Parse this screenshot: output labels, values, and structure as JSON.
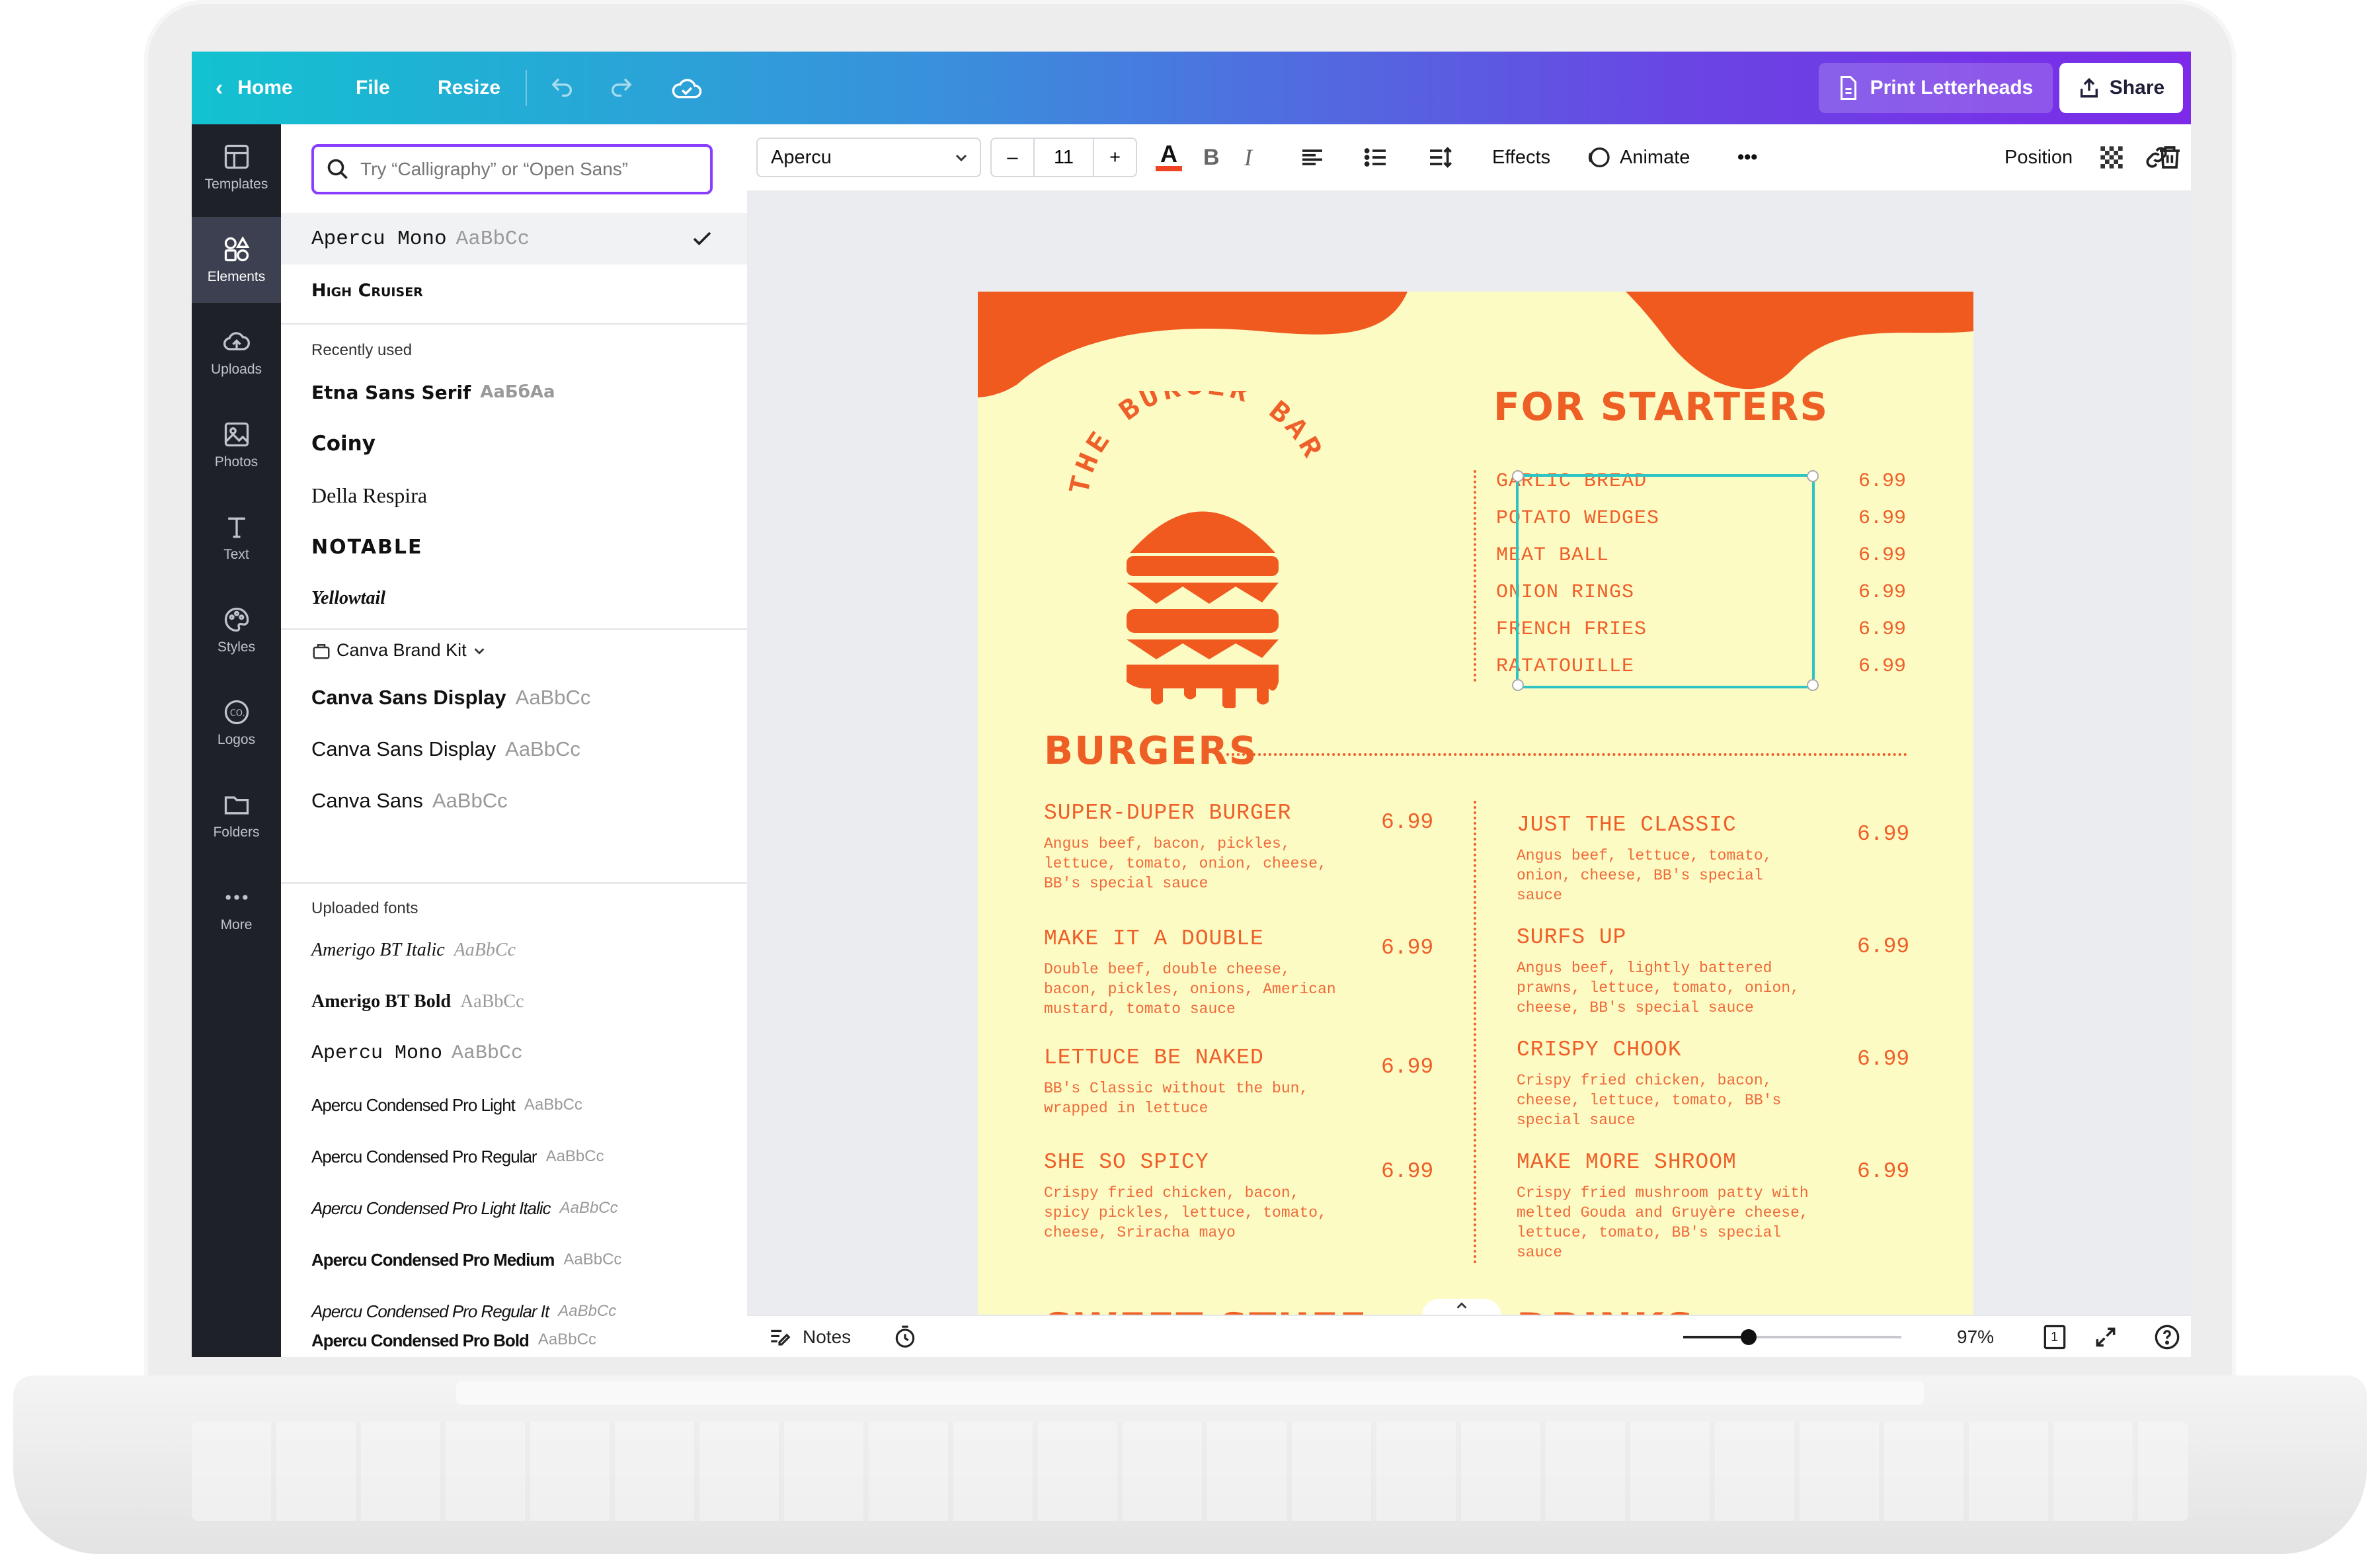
{
  "topbar": {
    "home": "Home",
    "file": "File",
    "resize": "Resize",
    "print": "Print Letterheads",
    "share": "Share"
  },
  "rail": [
    {
      "label": "Templates",
      "icon": "templates-icon"
    },
    {
      "label": "Elements",
      "icon": "elements-icon"
    },
    {
      "label": "Uploads",
      "icon": "uploads-icon"
    },
    {
      "label": "Photos",
      "icon": "photos-icon"
    },
    {
      "label": "Text",
      "icon": "text-icon"
    },
    {
      "label": "Styles",
      "icon": "styles-icon"
    },
    {
      "label": "Logos",
      "icon": "logos-icon"
    },
    {
      "label": "Folders",
      "icon": "folders-icon"
    },
    {
      "label": "More",
      "icon": "more-icon"
    }
  ],
  "panel": {
    "search_placeholder": "Try “Calligraphy” or “Open Sans”",
    "top_fonts": [
      {
        "name": "Apercu Mono",
        "sample": "AaBbCc"
      },
      {
        "name": "High Cruiser",
        "sample": ""
      }
    ],
    "recent_label": "Recently used",
    "recent": [
      {
        "name": "Etna Sans Serif",
        "sample": "AaБбAa"
      },
      {
        "name": "Coiny",
        "sample": ""
      },
      {
        "name": "Della Respira",
        "sample": ""
      },
      {
        "name": "NOTABLE",
        "sample": ""
      },
      {
        "name": "Yellowtail",
        "sample": ""
      }
    ],
    "brand_label": "Canva Brand Kit",
    "brand": [
      {
        "name": "Canva Sans Display",
        "sample": "AaBbCc"
      },
      {
        "name": "Canva Sans Display",
        "sample": "AaBbCc"
      },
      {
        "name": "Canva Sans",
        "sample": "AaBbCc"
      }
    ],
    "uploaded_label": "Uploaded fonts",
    "uploaded": [
      {
        "name": "Amerigo BT Italic",
        "sample": "AaBbCc"
      },
      {
        "name": "Amerigo BT Bold",
        "sample": "AaBbCc"
      },
      {
        "name": "Apercu Mono",
        "sample": "AaBbCc"
      },
      {
        "name": "Apercu Condensed Pro Light",
        "sample": "AaBbCc"
      },
      {
        "name": "Apercu Condensed Pro Regular",
        "sample": "AaBbCc"
      },
      {
        "name": "Apercu Condensed Pro Light Italic",
        "sample": "AaBbCc"
      },
      {
        "name": "Apercu Condensed Pro Medium",
        "sample": "AaBbCc"
      },
      {
        "name": "Apercu Condensed Pro Regular It",
        "sample": "AaBbCc"
      },
      {
        "name": "Apercu Condensed Pro Bold",
        "sample": "AaBbCc"
      }
    ]
  },
  "toolbar": {
    "font": "Apercu",
    "minus": "–",
    "size": "11",
    "plus": "+",
    "bold": "B",
    "italic": "I",
    "effects": "Effects",
    "animate": "Animate",
    "more": "•••",
    "position": "Position"
  },
  "menu": {
    "logo_text": "THE BURGER BAR",
    "starters_title": "FOR STARTERS",
    "starters": [
      {
        "name": "GARLIC BREAD",
        "price": "6.99"
      },
      {
        "name": "POTATO WEDGES",
        "price": "6.99"
      },
      {
        "name": "MEAT BALL",
        "price": "6.99"
      },
      {
        "name": "ONION RINGS",
        "price": "6.99"
      },
      {
        "name": "FRENCH FRIES",
        "price": "6.99"
      },
      {
        "name": "RATATOUILLE",
        "price": "6.99"
      }
    ],
    "burgers_title": "BURGERS",
    "burgers_left": [
      {
        "name": "SUPER-DUPER BURGER",
        "price": "6.99",
        "desc": [
          "Angus beef, bacon, pickles,",
          "lettuce, tomato, onion, cheese,",
          "BB's special sauce"
        ]
      },
      {
        "name": "MAKE IT A DOUBLE",
        "price": "6.99",
        "desc": [
          "Double beef, double cheese,",
          "bacon, pickles, onions, American",
          "mustard, tomato sauce"
        ]
      },
      {
        "name": "LETTUCE BE NAKED",
        "price": "6.99",
        "desc": [
          "BB's Classic without the bun,",
          "wrapped in lettuce"
        ]
      },
      {
        "name": "SHE SO SPICY",
        "price": "6.99",
        "desc": [
          "Crispy fried chicken, bacon,",
          "spicy pickles, lettuce, tomato,",
          "cheese, Sriracha mayo"
        ]
      }
    ],
    "burgers_right": [
      {
        "name": "JUST THE CLASSIC",
        "price": "6.99",
        "desc": [
          "Angus beef, lettuce, tomato,",
          "onion, cheese, BB's special",
          "sauce"
        ]
      },
      {
        "name": "SURFS UP",
        "price": "6.99",
        "desc": [
          "Angus beef, lightly battered",
          "prawns, lettuce, tomato, onion,",
          "cheese, BB's special sauce"
        ]
      },
      {
        "name": "CRISPY CHOOK",
        "price": "6.99",
        "desc": [
          "Crispy fried chicken, bacon,",
          "cheese, lettuce, tomato, BB's",
          "special sauce"
        ]
      },
      {
        "name": "MAKE MORE SHROOM",
        "price": "6.99",
        "desc": [
          "Crispy fried mushroom patty with",
          "melted Gouda and Gruyère cheese,",
          "lettuce, tomato, BB's special",
          "sauce"
        ]
      }
    ],
    "sweet_title": "SWEET STUFF",
    "drinks_title": "DRINKS"
  },
  "bottombar": {
    "notes": "Notes",
    "zoom": "97%",
    "page": "1",
    "zoom_level": 0.3
  },
  "colors": {
    "accent": "#8b3dff",
    "menu_orange": "#ef5f29",
    "menu_bg": "#fdfbc4",
    "selection": "#2ec4c4"
  }
}
